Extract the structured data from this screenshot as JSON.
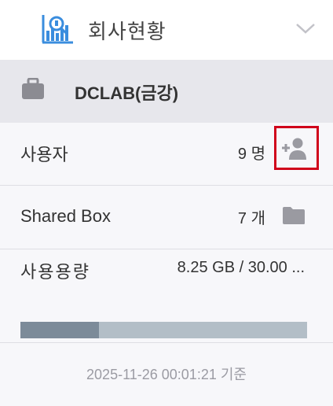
{
  "header": {
    "title": "회사현황",
    "icon": "company-stats-icon",
    "toggle_icon": "chevron-down-icon"
  },
  "company": {
    "icon": "briefcase-icon",
    "name": "DCLAB(금강)"
  },
  "users": {
    "label": "사용자",
    "value": "9 명",
    "action_icon": "add-user-icon"
  },
  "shared_box": {
    "label": "Shared Box",
    "value": "7 개",
    "icon": "folder-icon"
  },
  "usage": {
    "label": "사용용량",
    "value": "8.25 GB / 30.00 ...",
    "fraction": 0.275
  },
  "footer": {
    "timestamp": "2025-11-26 00:01:21 기준"
  },
  "colors": {
    "accent_blue": "#3a8dde",
    "highlight_red": "#d0021b",
    "icon_gray": "#9a9aa1",
    "bar_track": "#b3bec7"
  }
}
